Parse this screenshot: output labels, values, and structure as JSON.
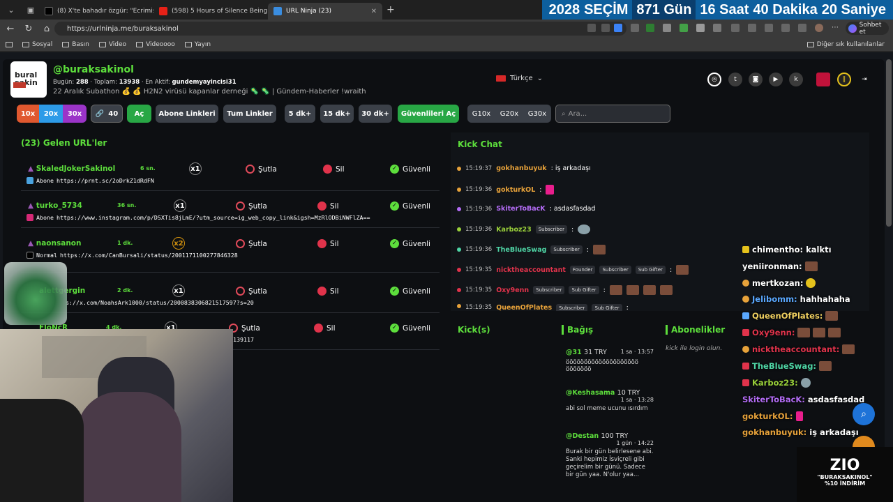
{
  "browser": {
    "tabs": [
      {
        "title": "(8) X'te bahadır özgür: \"Ecrimisil c..",
        "icon": "x-icon"
      },
      {
        "title": "(598) 5 Hours of Silence Being Ra..",
        "icon": "youtube-icon"
      },
      {
        "title": "URL Ninja (23)",
        "icon": "urlninja-icon"
      }
    ],
    "url": "https://urlninja.me/buraksakinol",
    "chat_button": "Sohbet et",
    "bookmarks": [
      "Sosyal",
      "Basın",
      "Video",
      "Videoooo",
      "Yayın"
    ],
    "bookmarks_right": "Diğer sık kullanılanlar"
  },
  "countdown": {
    "year": "2028",
    "label": "SEÇİM",
    "days": "871 Gün",
    "hours": "16 Saat",
    "minutes": "40 Dakika",
    "seconds": "20 Saniye"
  },
  "profile": {
    "logo_text": "bural\nsakin",
    "username": "@buraksakinol",
    "today_label": "Bugün:",
    "today": "288",
    "total_label": "Toplam:",
    "total": "13938",
    "active_label": "En Aktif:",
    "active": "gundemyayincisi31",
    "subline": "22 Aralık Subathon 💰 💰 H2N2 virüsü kapanlar derneği 🦠 🦠 | Gündem-Haberler !wraith",
    "language": "Türkçe"
  },
  "toolbar": {
    "m10": "10x",
    "m20": "20x",
    "m30": "30x",
    "link_count": "40",
    "open": "Aç",
    "sub_links": "Abone Linkleri",
    "all_links": "Tum Linkler",
    "d5": "5 dk+",
    "d15": "15 dk+",
    "d30": "30 dk+",
    "open_safe": "Güvenlileri Aç",
    "g10": "G10x",
    "g20": "G20x",
    "g30": "G30x",
    "search_placeholder": "Ara..."
  },
  "incoming_title": "(23) Gelen URL'ler",
  "actions": {
    "kick": "Şutla",
    "delete": "Sil",
    "safe": "Güvenli"
  },
  "urls": [
    {
      "user": "SkaledJokerSakinol",
      "time": "6 sn.",
      "mult": "x1",
      "type": "Abone",
      "link": "https://prnt.sc/2oDrkZ1dRdFN"
    },
    {
      "user": "turko_5734",
      "time": "36 sn.",
      "mult": "x1",
      "type": "Abone",
      "link": "https://www.instagram.com/p/DSXTis8jLmE/?utm_source=ig_web_copy_link&igsh=MzRlODBiNWFlZA=="
    },
    {
      "user": "naonsanon",
      "time": "1 dk.",
      "mult": "x2",
      "type": "Normal",
      "link": "https://x.com/CanBursali/status/2001171100277846328"
    },
    {
      "user": "alettgergin",
      "time": "2 dk.",
      "mult": "x1",
      "type": "",
      "link": "s://x.com/NoahsArk1000/status/2000838306821517597?s=20"
    },
    {
      "user": "FloNcR",
      "time": "4 dk.",
      "mult": "x1",
      "type": "",
      "link": "139117"
    }
  ],
  "kick_chat": {
    "title": "Kick Chat",
    "messages": [
      {
        "time": "15:19:37",
        "user": "gokhanbuyuk",
        "text": ": iş arkadaşı",
        "color": "#e7a23a",
        "badges": []
      },
      {
        "time": "15:19:36",
        "user": "gokturkOL",
        "text": ":",
        "color": "#e7a23a",
        "badges": []
      },
      {
        "time": "15:19:36",
        "user": "SkiterToBacK",
        "text": ": asdasfasdad",
        "color": "#b36cf5",
        "badges": []
      },
      {
        "time": "15:19:36",
        "user": "Karboz23",
        "text": ":",
        "color": "#9ad13a",
        "badges": [
          "Subscriber"
        ]
      },
      {
        "time": "15:19:36",
        "user": "TheBlueSwag",
        "text": ":",
        "color": "#4fd6a6",
        "badges": [
          "Subscriber"
        ]
      },
      {
        "time": "15:19:35",
        "user": "nicktheaccountant",
        "text": ":",
        "color": "#e0334b",
        "badges": [
          "Founder",
          "Subscriber",
          "Sub Gifter"
        ]
      },
      {
        "time": "15:19:35",
        "user": "Oxy9enn",
        "text": ":",
        "color": "#e0334b",
        "badges": [
          "Subscriber",
          "Sub Gifter"
        ]
      },
      {
        "time": "15:19:35",
        "user": "QueenOfPlates",
        "text": ":",
        "color": "#e7a23a",
        "badges": [
          "Subscriber",
          "Sub Gifter"
        ]
      }
    ]
  },
  "kicks_title": "Kick(s)",
  "donations": {
    "title": "Bağış",
    "items": [
      {
        "user": "@31",
        "amount": "31 TRY",
        "ago": "1 sa · 13:57",
        "text": "öööööööööööööööööööö ööööööö"
      },
      {
        "user": "@Keshasama",
        "amount": "10 TRY",
        "ago": "1 sa · 13:28",
        "text": "abi sol meme ucunu ısırdım"
      },
      {
        "user": "@Destan",
        "amount": "100 TRY",
        "ago": "1 gün · 14:22",
        "text": "Burak bir gün belirlesene abi. Sanki hepimiz İsviçreli gibi geçirelim bir günü. Sadece bir gün yaa. N'olur yaa..."
      }
    ]
  },
  "subscribers": {
    "title": "Abonelikler",
    "login_hint": "kick ile login olun."
  },
  "overlay_chat": [
    {
      "user": "chimentho:",
      "text": "kalktı",
      "color": "#ffffff"
    },
    {
      "user": "yeniironman:",
      "text": "",
      "color": "#ffffff"
    },
    {
      "user": "mertkozan:",
      "text": "",
      "color": "#ffffff"
    },
    {
      "user": "Jelibomm:",
      "text": "hahhahaha",
      "color": "#5aa8ff"
    },
    {
      "user": "QueenOfPlates:",
      "text": "",
      "color": "#f0d060"
    },
    {
      "user": "Oxy9enn:",
      "text": "",
      "color": "#e0334b"
    },
    {
      "user": "nicktheaccountant:",
      "text": "",
      "color": "#e0334b"
    },
    {
      "user": "TheBlueSwag:",
      "text": "",
      "color": "#4fd6a6"
    },
    {
      "user": "Karboz23:",
      "text": "",
      "color": "#9ad13a"
    },
    {
      "user": "SkiterToBacK:",
      "text": "asdasfasdad",
      "color": "#b36cf5"
    },
    {
      "user": "gokturkOL:",
      "text": "",
      "color": "#e7a23a"
    },
    {
      "user": "gokhanbuyuk:",
      "text": "iş arkadaşı",
      "color": "#e7a23a"
    }
  ],
  "sponsor": {
    "brand": "ZIO",
    "code": "\"BURAKSAKINOL\"",
    "discount": "%10 İNDİRİM"
  },
  "colors": {
    "accent": "#5dde3c",
    "danger": "#e0334b",
    "countdown_bg": "#0d5f9e"
  }
}
